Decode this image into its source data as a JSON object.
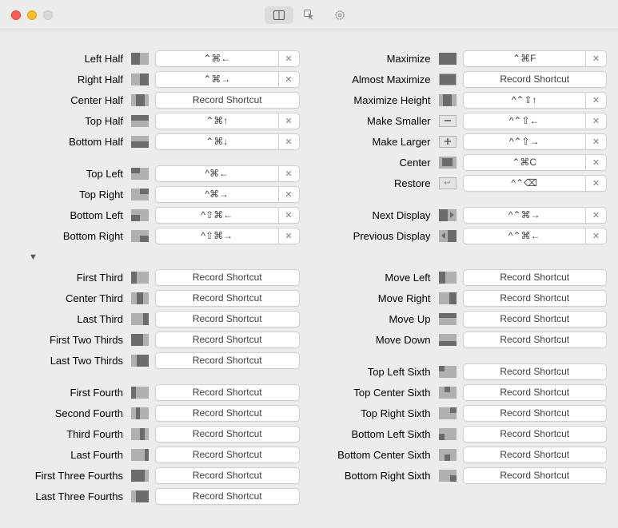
{
  "record_placeholder": "Record Shortcut",
  "toolbar_tabs": [
    "layout",
    "snap",
    "settings"
  ],
  "groups": {
    "halves": [
      {
        "label": "Left Half",
        "icon": "i-left",
        "shortcut": "⌃⌘←",
        "has_clear": true
      },
      {
        "label": "Right Half",
        "icon": "i-right",
        "shortcut": "⌃⌘→",
        "has_clear": true
      },
      {
        "label": "Center Half",
        "icon": "i-centerh",
        "shortcut": "",
        "has_clear": false
      },
      {
        "label": "Top Half",
        "icon": "i-top",
        "shortcut": "⌃⌘↑",
        "has_clear": true
      },
      {
        "label": "Bottom Half",
        "icon": "i-bottom",
        "shortcut": "⌃⌘↓",
        "has_clear": true
      }
    ],
    "corners": [
      {
        "label": "Top Left",
        "icon": "i-tl",
        "shortcut": "^⌘←",
        "has_clear": true
      },
      {
        "label": "Top Right",
        "icon": "i-tr",
        "shortcut": "^⌘→",
        "has_clear": true
      },
      {
        "label": "Bottom Left",
        "icon": "i-bl",
        "shortcut": "^⇧⌘←",
        "has_clear": true
      },
      {
        "label": "Bottom Right",
        "icon": "i-br",
        "shortcut": "^⇧⌘→",
        "has_clear": true
      }
    ],
    "maxi": [
      {
        "label": "Maximize",
        "icon": "i-full",
        "shortcut": "⌃⌘F",
        "has_clear": true
      },
      {
        "label": "Almost Maximize",
        "icon": "i-almost",
        "shortcut": "",
        "has_clear": false
      },
      {
        "label": "Maximize Height",
        "icon": "i-maxh",
        "shortcut": "^⌃⇧↑",
        "has_clear": true
      },
      {
        "label": "Make Smaller",
        "icon": "i-op minus",
        "shortcut": "^⌃⇧←",
        "has_clear": true,
        "special": true
      },
      {
        "label": "Make Larger",
        "icon": "i-op plus",
        "shortcut": "^⌃⇧→",
        "has_clear": true,
        "special": true
      },
      {
        "label": "Center",
        "icon": "i-centerbox",
        "shortcut": "⌃⌘C",
        "has_clear": true
      },
      {
        "label": "Restore",
        "icon": "i-restore",
        "shortcut": "^⌃⌫",
        "has_clear": true,
        "special": true,
        "glyph": "↩"
      }
    ],
    "display": [
      {
        "label": "Next Display",
        "icon": "i-next",
        "shortcut": "^⌃⌘→",
        "has_clear": true
      },
      {
        "label": "Previous Display",
        "icon": "i-prev",
        "shortcut": "^⌃⌘←",
        "has_clear": true
      }
    ],
    "thirds": [
      {
        "label": "First Third",
        "icon": "i-third1",
        "shortcut": "",
        "has_clear": false
      },
      {
        "label": "Center Third",
        "icon": "i-third2",
        "shortcut": "",
        "has_clear": false
      },
      {
        "label": "Last Third",
        "icon": "i-third3",
        "shortcut": "",
        "has_clear": false
      },
      {
        "label": "First Two Thirds",
        "icon": "i-twothird1",
        "shortcut": "",
        "has_clear": false
      },
      {
        "label": "Last Two Thirds",
        "icon": "i-twothird2",
        "shortcut": "",
        "has_clear": false
      }
    ],
    "fourths": [
      {
        "label": "First Fourth",
        "icon": "i-q1",
        "shortcut": "",
        "has_clear": false
      },
      {
        "label": "Second Fourth",
        "icon": "i-q2",
        "shortcut": "",
        "has_clear": false
      },
      {
        "label": "Third Fourth",
        "icon": "i-q3",
        "shortcut": "",
        "has_clear": false
      },
      {
        "label": "Last Fourth",
        "icon": "i-q4",
        "shortcut": "",
        "has_clear": false
      },
      {
        "label": "First Three Fourths",
        "icon": "i-threeq1",
        "shortcut": "",
        "has_clear": false
      },
      {
        "label": "Last Three Fourths",
        "icon": "i-threeq2",
        "shortcut": "",
        "has_clear": false
      }
    ],
    "moves": [
      {
        "label": "Move Left",
        "icon": "i-ml",
        "shortcut": "",
        "has_clear": false
      },
      {
        "label": "Move Right",
        "icon": "i-mr",
        "shortcut": "",
        "has_clear": false
      },
      {
        "label": "Move Up",
        "icon": "i-mu",
        "shortcut": "",
        "has_clear": false
      },
      {
        "label": "Move Down",
        "icon": "i-md",
        "shortcut": "",
        "has_clear": false
      }
    ],
    "sixths": [
      {
        "label": "Top Left Sixth",
        "icon": "i-s-tl",
        "shortcut": "",
        "has_clear": false
      },
      {
        "label": "Top Center Sixth",
        "icon": "i-s-tc",
        "shortcut": "",
        "has_clear": false
      },
      {
        "label": "Top Right Sixth",
        "icon": "i-s-tr",
        "shortcut": "",
        "has_clear": false
      },
      {
        "label": "Bottom Left Sixth",
        "icon": "i-s-bl",
        "shortcut": "",
        "has_clear": false
      },
      {
        "label": "Bottom Center Sixth",
        "icon": "i-s-bc",
        "shortcut": "",
        "has_clear": false
      },
      {
        "label": "Bottom Right Sixth",
        "icon": "i-s-br",
        "shortcut": "",
        "has_clear": false
      }
    ]
  }
}
